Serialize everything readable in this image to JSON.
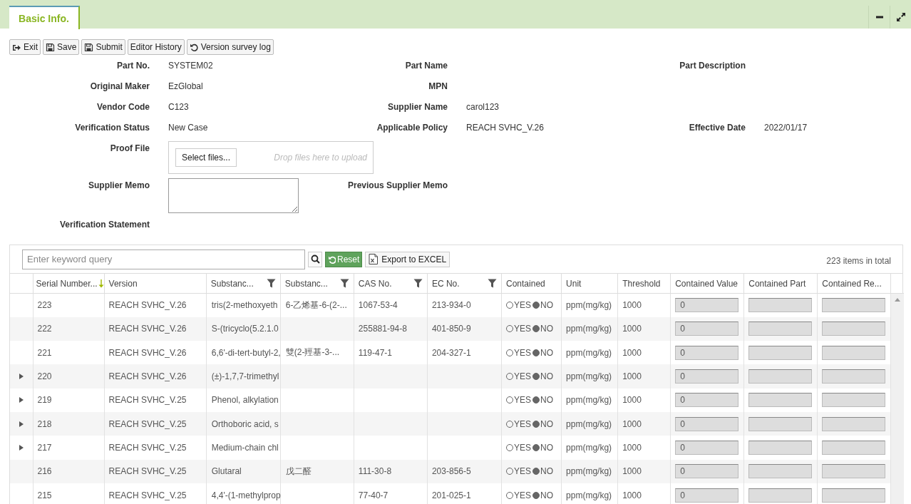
{
  "tabs": [
    {
      "label": "Basic Info.",
      "selected": true
    }
  ],
  "toolbar": [
    {
      "label": "Exit",
      "kind": "exit"
    },
    {
      "label": "Save",
      "kind": "save"
    },
    {
      "label": "Submit",
      "kind": "save"
    },
    {
      "label": "Editor History",
      "kind": "plain"
    },
    {
      "label": "Version survey log",
      "kind": "history"
    }
  ],
  "form": [
    [
      {
        "label": "Part No.",
        "value": "SYSTEM02",
        "kind": "text"
      },
      {
        "label": "Part Name",
        "kind": "text"
      },
      {
        "label": "Part Description",
        "kind": "text"
      }
    ],
    [
      {
        "label": "Original Maker",
        "value": "EzGlobal",
        "kind": "text"
      },
      {
        "label": "MPN",
        "kind": "text"
      }
    ],
    [
      {
        "label": "Vendor Code",
        "value": "C123",
        "kind": "text"
      },
      {
        "label": "Supplier Name",
        "value": "carol123",
        "kind": "text"
      }
    ],
    [
      {
        "label": "Verification Status",
        "value": "New Case",
        "kind": "text"
      },
      {
        "label": "Applicable Policy",
        "value": "REACH SVHC_V.26",
        "kind": "text"
      },
      {
        "label": "Effective Date",
        "value": "2022/01/17",
        "kind": "text"
      }
    ],
    [
      {
        "label": "Proof File",
        "kind": "upload",
        "button": "Select files...",
        "hint": "Drop files here to upload"
      }
    ],
    [
      {
        "label": "Supplier Memo",
        "kind": "textarea"
      },
      {
        "label": "Previous Supplier Memo",
        "kind": "text"
      }
    ],
    [
      {
        "label": "Verification Statement",
        "kind": "text"
      }
    ]
  ],
  "grid": {
    "search": {
      "placeholder": "Enter keyword query"
    },
    "reset": "Reset",
    "export": "Export to EXCEL",
    "total": "223 items in total",
    "columns": [
      {
        "label": "Serial Number...",
        "sorted": true
      },
      {
        "label": "Version"
      },
      {
        "label": "Substanc...",
        "filter": true
      },
      {
        "label": "Substanc...",
        "filter": true
      },
      {
        "label": "CAS No.",
        "filter": true
      },
      {
        "label": "EC No.",
        "filter": true
      },
      {
        "label": "Contained"
      },
      {
        "label": "Unit"
      },
      {
        "label": "Threshold"
      },
      {
        "label": "Contained Value"
      },
      {
        "label": "Contained Part"
      },
      {
        "label": "Contained Re..."
      }
    ],
    "rows": [
      {
        "expandable": false,
        "cells": [
          "223",
          "REACH SVHC_V.26",
          "tris(2-methoxyeth",
          "6-乙烯基-6-(2-...",
          "1067-53-4",
          "213-934-0"
        ],
        "options": [
          {
            "label": "YES",
            "selected": false
          },
          {
            "label": "NO",
            "selected": true
          }
        ],
        "unit": "ppm(mg/kg)",
        "threshold": "1000",
        "contained_value": "0"
      },
      {
        "expandable": false,
        "cells": [
          "222",
          "REACH SVHC_V.26",
          "S-(tricyclo(5.2.1.0",
          "",
          "255881-94-8",
          "401-850-9"
        ],
        "options": [
          {
            "label": "YES",
            "selected": false
          },
          {
            "label": "NO",
            "selected": true
          }
        ],
        "unit": "ppm(mg/kg)",
        "threshold": "1000",
        "contained_value": "0"
      },
      {
        "expandable": false,
        "cells": [
          "221",
          "REACH SVHC_V.26",
          "6,6'-di-tert-butyl-2,",
          "雙(2-羥基-3-...",
          "119-47-1",
          "204-327-1"
        ],
        "options": [
          {
            "label": "YES",
            "selected": false
          },
          {
            "label": "NO",
            "selected": true
          }
        ],
        "unit": "ppm(mg/kg)",
        "threshold": "1000",
        "contained_value": "0"
      },
      {
        "expandable": true,
        "cells": [
          "220",
          "REACH SVHC_V.26",
          "(±)-1,7,7-trimethyl",
          "",
          "",
          ""
        ],
        "options": [
          {
            "label": "YES",
            "selected": false
          },
          {
            "label": "NO",
            "selected": true
          }
        ],
        "unit": "ppm(mg/kg)",
        "threshold": "1000",
        "contained_value": "0"
      },
      {
        "expandable": true,
        "cells": [
          "219",
          "REACH SVHC_V.25",
          "Phenol, alkylation",
          "",
          "",
          ""
        ],
        "options": [
          {
            "label": "YES",
            "selected": false
          },
          {
            "label": "NO",
            "selected": true
          }
        ],
        "unit": "ppm(mg/kg)",
        "threshold": "1000",
        "contained_value": "0"
      },
      {
        "expandable": true,
        "cells": [
          "218",
          "REACH SVHC_V.25",
          "Orthoboric acid, s",
          "",
          "",
          ""
        ],
        "options": [
          {
            "label": "YES",
            "selected": false
          },
          {
            "label": "NO",
            "selected": true
          }
        ],
        "unit": "ppm(mg/kg)",
        "threshold": "1000",
        "contained_value": "0"
      },
      {
        "expandable": true,
        "cells": [
          "217",
          "REACH SVHC_V.25",
          "Medium-chain chl",
          "",
          "",
          ""
        ],
        "options": [
          {
            "label": "YES",
            "selected": false
          },
          {
            "label": "NO",
            "selected": true
          }
        ],
        "unit": "ppm(mg/kg)",
        "threshold": "1000",
        "contained_value": "0"
      },
      {
        "expandable": false,
        "cells": [
          "216",
          "REACH SVHC_V.25",
          "Glutaral",
          "戊二醛",
          "111-30-8",
          "203-856-5"
        ],
        "options": [
          {
            "label": "YES",
            "selected": false
          },
          {
            "label": "NO",
            "selected": true
          }
        ],
        "unit": "ppm(mg/kg)",
        "threshold": "1000",
        "contained_value": "0"
      },
      {
        "expandable": false,
        "cells": [
          "215",
          "REACH SVHC_V.25",
          "4,4'-(1-methylprop",
          "",
          "77-40-7",
          "201-025-1"
        ],
        "options": [
          {
            "label": "YES",
            "selected": false
          },
          {
            "label": "NO",
            "selected": true
          }
        ],
        "unit": "ppm(mg/kg)",
        "threshold": "1000",
        "contained_value": "0"
      }
    ]
  }
}
